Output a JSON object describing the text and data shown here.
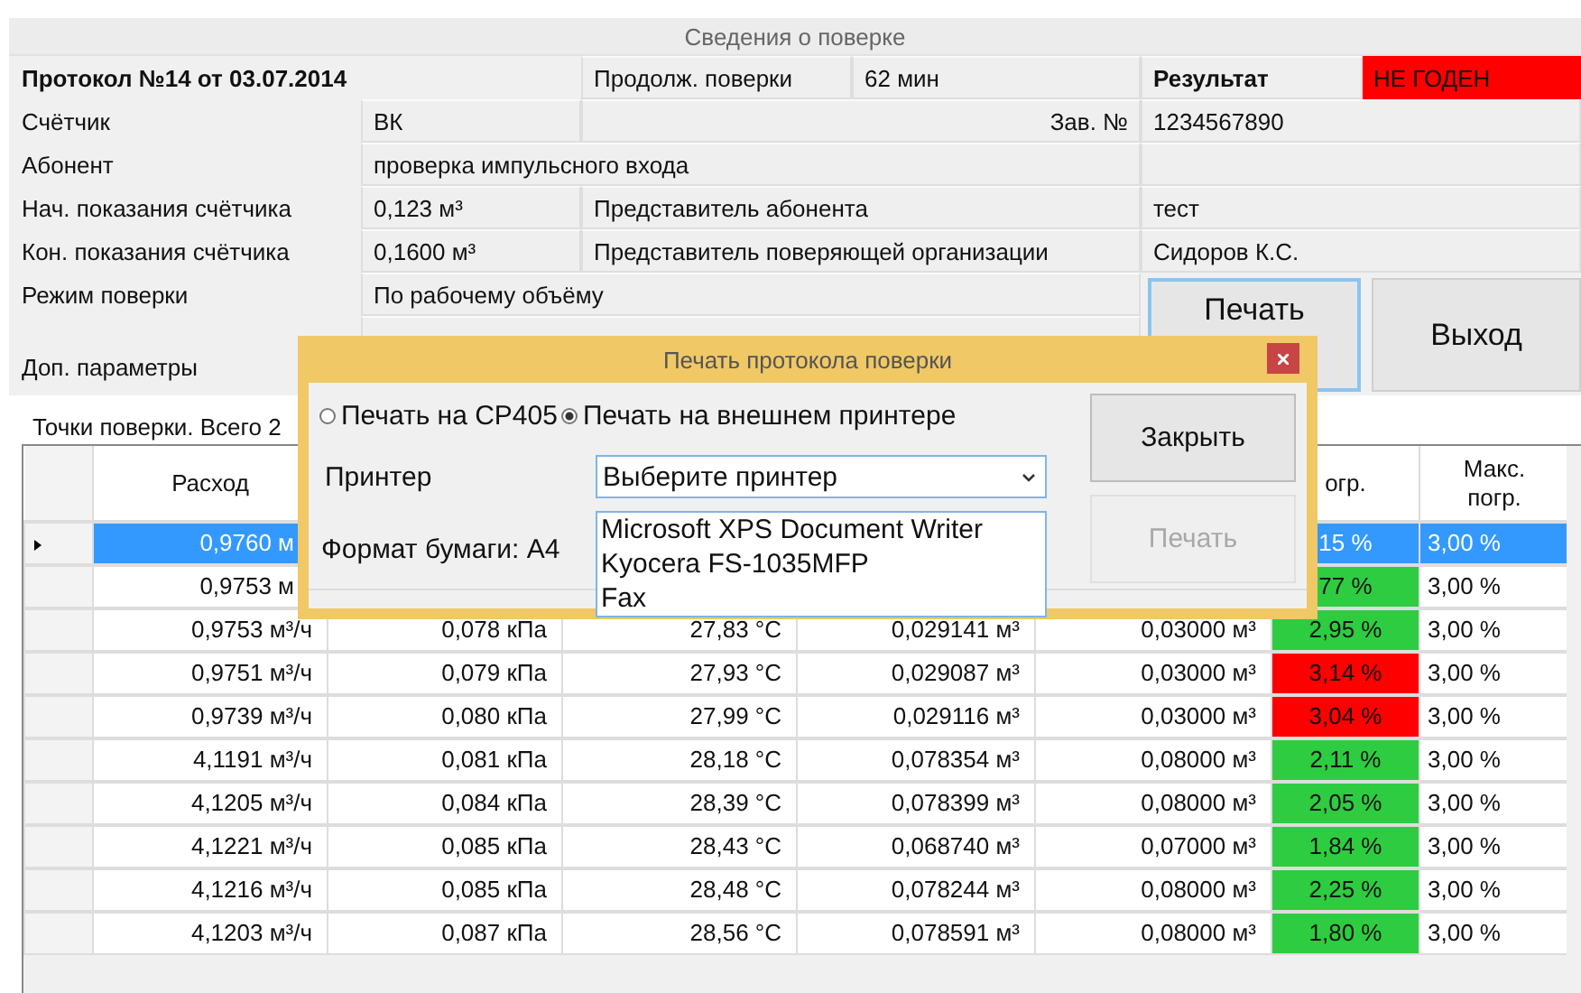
{
  "window": {
    "title": "Сведения о поверке"
  },
  "protocol": {
    "title": "Протокол №14 от 03.07.2014",
    "duration_label": "Продолж. поверки",
    "duration": "62 мин",
    "result_label": "Результат",
    "result": "НЕ ГОДЕН",
    "passed": false
  },
  "meter": {
    "label": "Счётчик",
    "value": "ВК",
    "serial_label": "Зав. №",
    "serial": "1234567890"
  },
  "subscriber": {
    "label": "Абонент",
    "value": "проверка импульсного входа"
  },
  "readings": [
    {
      "label": "Нач. показания счётчика",
      "value": "0,123 м³",
      "rep_label": "Представитель абонента",
      "rep": "тест"
    },
    {
      "label": "Кон. показания счётчика",
      "value": "0,1600 м³",
      "rep_label": "Представитель поверяющей организации",
      "rep": "Сидоров К.С."
    }
  ],
  "mode": {
    "label": "Режим поверки",
    "value": "По рабочему объёму"
  },
  "extra": {
    "label": "Доп. параметры"
  },
  "buttons": [
    {
      "label": "Печать",
      "focused": true
    },
    {
      "label": "Выход",
      "focused": false
    }
  ],
  "points": {
    "caption": "Точки поверки. Всего 2",
    "columns": {
      "flow": "Расход",
      "error": "огр.",
      "max_error": "Макс. погр."
    },
    "rows": [
      {
        "selected": true,
        "flow": "0,9760 м",
        "error": "15 %",
        "max_error": "3,00 %"
      },
      {
        "selected": false,
        "passed": true,
        "flow": "0,9753 м",
        "error": "77 %",
        "max_error": "3,00 %"
      },
      {
        "selected": false,
        "passed": true,
        "flow": "0,9753 м³/ч",
        "pressure": "0,078 кПа",
        "temp": "27,83 °C",
        "volume": "0,029141 м³",
        "ref_volume": "0,03000 м³",
        "error": "2,95 %",
        "max_error": "3,00 %"
      },
      {
        "selected": false,
        "passed": false,
        "flow": "0,9751 м³/ч",
        "pressure": "0,079 кПа",
        "temp": "27,93 °C",
        "volume": "0,029087 м³",
        "ref_volume": "0,03000 м³",
        "error": "3,14 %",
        "max_error": "3,00 %"
      },
      {
        "selected": false,
        "passed": false,
        "flow": "0,9739 м³/ч",
        "pressure": "0,080 кПа",
        "temp": "27,99 °C",
        "volume": "0,029116 м³",
        "ref_volume": "0,03000 м³",
        "error": "3,04 %",
        "max_error": "3,00 %"
      },
      {
        "selected": false,
        "passed": true,
        "flow": "4,1191 м³/ч",
        "pressure": "0,081 кПа",
        "temp": "28,18 °C",
        "volume": "0,078354 м³",
        "ref_volume": "0,08000 м³",
        "error": "2,11 %",
        "max_error": "3,00 %"
      },
      {
        "selected": false,
        "passed": true,
        "flow": "4,1205 м³/ч",
        "pressure": "0,084 кПа",
        "temp": "28,39 °C",
        "volume": "0,078399 м³",
        "ref_volume": "0,08000 м³",
        "error": "2,05 %",
        "max_error": "3,00 %"
      },
      {
        "selected": false,
        "passed": true,
        "flow": "4,1221 м³/ч",
        "pressure": "0,085 кПа",
        "temp": "28,43 °C",
        "volume": "0,068740 м³",
        "ref_volume": "0,07000 м³",
        "error": "1,84 %",
        "max_error": "3,00 %"
      },
      {
        "selected": false,
        "passed": true,
        "flow": "4,1216 м³/ч",
        "pressure": "0,085 кПа",
        "temp": "28,48 °C",
        "volume": "0,078244 м³",
        "ref_volume": "0,08000 м³",
        "error": "2,25 %",
        "max_error": "3,00 %"
      },
      {
        "selected": false,
        "passed": true,
        "flow": "4,1203 м³/ч",
        "pressure": "0,087 кПа",
        "temp": "28,56 °C",
        "volume": "0,078591 м³",
        "ref_volume": "0,08000 м³",
        "error": "1,80 %",
        "max_error": "3,00 %"
      }
    ]
  },
  "dialog": {
    "title": "Печать протокола поверки",
    "options": [
      {
        "label": "Печать на CP405",
        "selected": false
      },
      {
        "label": "Печать на внешнем принтере",
        "selected": true
      }
    ],
    "printer_label": "Принтер",
    "printer_value": "Выберите принтер",
    "dropdown": {
      "expanded": true,
      "items": [
        "Microsoft XPS Document Writer",
        "Kyocera FS-1035MFP",
        "Fax"
      ]
    },
    "paper": "Формат бумаги: A4",
    "buttons": [
      {
        "label": "Закрыть",
        "disabled": false
      },
      {
        "label": "Печать",
        "disabled": true
      }
    ]
  }
}
